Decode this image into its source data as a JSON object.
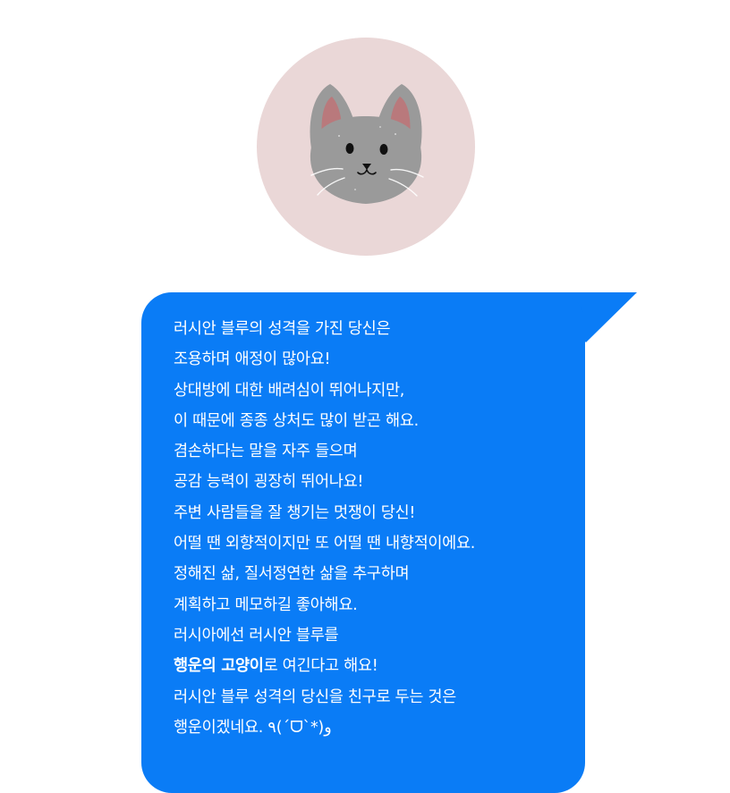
{
  "avatar": {
    "icon": "gray-cat-face-icon",
    "background": "#ead7d7",
    "cat_color": "#9a9a9a",
    "ear_color": "#b9797c"
  },
  "bubble": {
    "color": "#0a7cf6",
    "lines": [
      "러시안 블루의 성격을 가진 당신은",
      "조용하며 애정이 많아요!",
      "상대방에 대한 배려심이 뛰어나지만,",
      "이 때문에 종종 상처도 많이 받곤 해요.",
      "겸손하다는 말을 자주 들으며",
      "공감 능력이 굉장히 뛰어나요!",
      "주변 사람들을 잘 챙기는 멋쟁이 당신!",
      "어떨 땐 외향적이지만 또 어떨 땐 내향적이에요.",
      "정해진 삶, 질서정연한 삶을 추구하며",
      "계획하고 메모하길 좋아해요.",
      "러시아에선 러시안 블루를"
    ],
    "lucky_bold": "행운의 고양이",
    "lucky_rest": "로 여긴다고 해요!",
    "line_friend": "러시안 블루 성격의 당신을 친구로 두는 것은",
    "line_last": "행운이겠네요. ٩(ˊᗜˋ*)و"
  }
}
